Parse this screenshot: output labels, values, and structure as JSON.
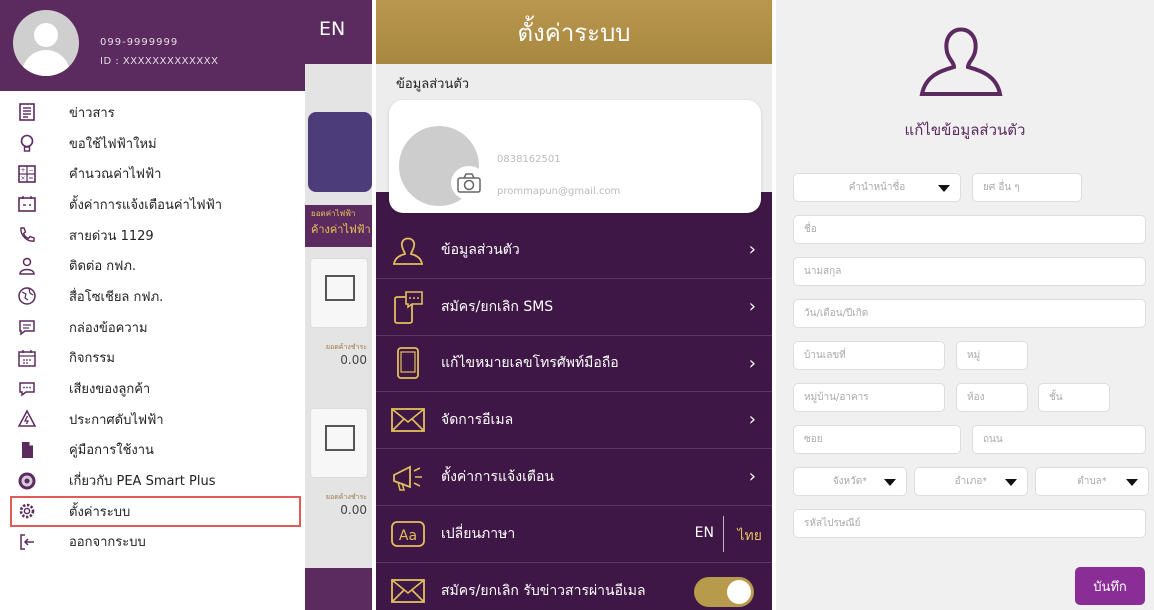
{
  "panel1": {
    "behind": {
      "lang": "EN",
      "strip_small": "ยอดค่าไฟฟ้า",
      "strip_big": "ค้างค่าไฟฟ้า",
      "value_label": "ยอดค้างชำระ",
      "value1": "0.00",
      "value2": "0.00"
    },
    "drawer": {
      "phone": "099-9999999",
      "id": "ID : XXXXXXXXXXXXX",
      "items": [
        {
          "label": "ข่าวสาร",
          "icon": "news-icon"
        },
        {
          "label": "ขอใช้ไฟฟ้าใหม่",
          "icon": "lightbulb-icon"
        },
        {
          "label": "คำนวณค่าไฟฟ้า",
          "icon": "calculator-icon"
        },
        {
          "label": "ตั้งค่าการแจ้งเตือนค่าไฟฟ้า",
          "icon": "meter-icon"
        },
        {
          "label": "สายด่วน 1129",
          "icon": "phone-icon"
        },
        {
          "label": "ติดต่อ กฟภ.",
          "icon": "contact-icon"
        },
        {
          "label": "สื่อโซเชียล กฟภ.",
          "icon": "globe-icon"
        },
        {
          "label": "กล่องข้อความ",
          "icon": "message-icon"
        },
        {
          "label": "กิจกรรม",
          "icon": "calendar-icon"
        },
        {
          "label": "เสียงของลูกค้า",
          "icon": "chat-icon"
        },
        {
          "label": "ประกาศดับไฟฟ้า",
          "icon": "warning-icon"
        },
        {
          "label": "คู่มือการใช้งาน",
          "icon": "manual-icon"
        },
        {
          "label": "เกี่ยวกับ PEA Smart Plus",
          "icon": "pea-logo-icon"
        },
        {
          "label": "ตั้งค่าระบบ",
          "icon": "gear-icon"
        },
        {
          "label": "ออกจากระบบ",
          "icon": "logout-icon"
        }
      ]
    }
  },
  "panel2": {
    "title": "ตั้งค่าระบบ",
    "section": "ข้อมูลส่วนตัว",
    "phone": "0838162501",
    "email": "prommapun@gmail.com",
    "rows": [
      {
        "label": "ข้อมูลส่วนตัว",
        "icon": "user-icon"
      },
      {
        "label": "สมัคร/ยกเลิก SMS",
        "icon": "sms-icon"
      },
      {
        "label": "แก้ไขหมายเลขโทรศัพท์มือถือ",
        "icon": "mobile-icon"
      },
      {
        "label": "จัดการอีเมล",
        "icon": "mail-icon"
      },
      {
        "label": "ตั้งค่าการแจ้งเตือน",
        "icon": "megaphone-icon"
      },
      {
        "label": "เปลี่ยนภาษา",
        "icon": "language-icon"
      },
      {
        "label": "สมัคร/ยกเลิก รับข่าวสารผ่านอีเมล",
        "icon": "mail-icon"
      }
    ],
    "lang_en": "EN",
    "lang_th": "ไทย",
    "toggle_on": true
  },
  "panel3": {
    "title": "แก้ไขข้อมูลส่วนตัว",
    "fields": {
      "prefix": "คำนำหน้าชื่อ",
      "rank": "ยศ อื่น ๆ",
      "first_name": "ชื่อ",
      "last_name": "นามสกุล",
      "birth_date": "วัน/เดือน/ปีเกิด",
      "house_no": "บ้านเลขที่",
      "moo": "หมู่",
      "village": "หมู่บ้าน/อาคาร",
      "room": "ห้อง",
      "floor": "ชั้น",
      "soi": "ซอย",
      "road": "ถนน",
      "province": "จังหวัด*",
      "district": "อำเภอ*",
      "subdistrict": "ตำบล*",
      "postcode": "รหัสไปรษณีย์"
    },
    "save": "บันทึก"
  },
  "colors": {
    "purple": "#5b2a5f",
    "gold": "#b89a4d",
    "deep_purple": "#3f1746",
    "button": "#8a2d96",
    "highlight": "#e15b56"
  }
}
